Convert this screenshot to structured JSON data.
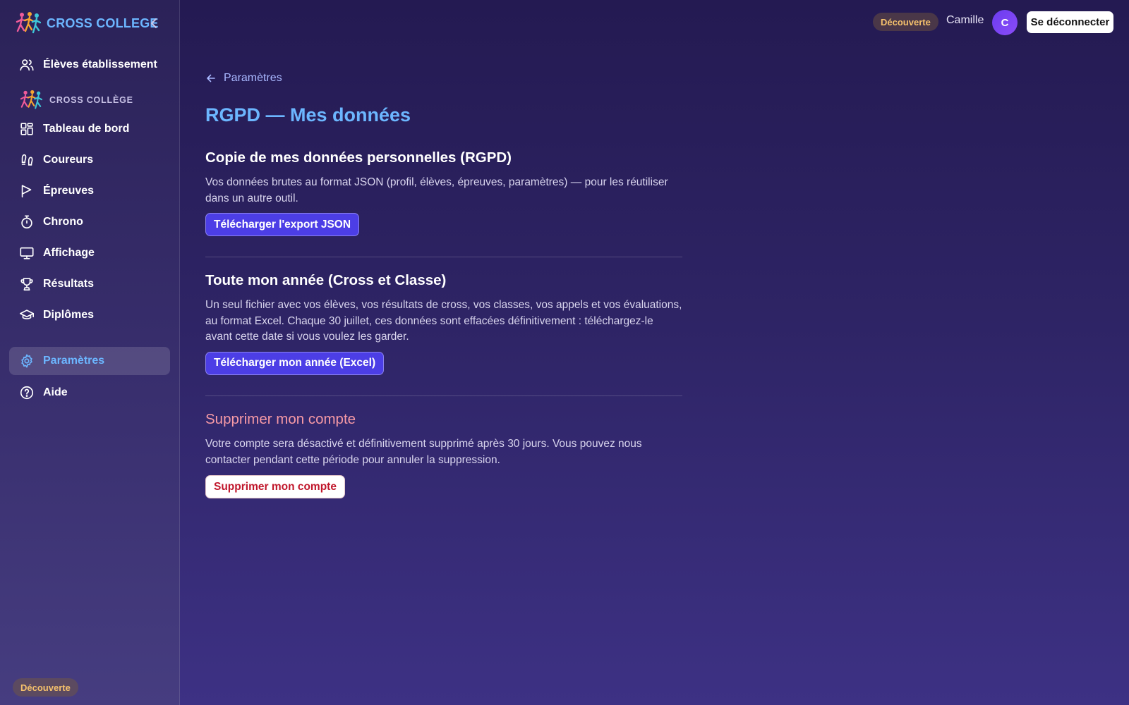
{
  "brand": {
    "name": "CROSS COLLEGE",
    "accent": "#6cb6ff"
  },
  "sidebar": {
    "top_item": {
      "label": "Élèves établissement",
      "icon": "users-icon"
    },
    "section_label": "CROSS COLLÈGE",
    "items": [
      {
        "label": "Tableau de bord",
        "icon": "dashboard-icon"
      },
      {
        "label": "Coureurs",
        "icon": "footprints-icon"
      },
      {
        "label": "Épreuves",
        "icon": "flag-icon"
      },
      {
        "label": "Chrono",
        "icon": "stopwatch-icon"
      },
      {
        "label": "Affichage",
        "icon": "monitor-icon"
      },
      {
        "label": "Résultats",
        "icon": "trophy-icon"
      },
      {
        "label": "Diplômes",
        "icon": "graduation-cap-icon"
      }
    ],
    "settings_item": {
      "label": "Paramètres",
      "icon": "gear-icon",
      "active": true
    },
    "help_item": {
      "label": "Aide",
      "icon": "help-circle-icon"
    },
    "plan_badge": "Découverte"
  },
  "header": {
    "plan_badge": "Découverte",
    "user_name": "Camille",
    "avatar_initial": "C",
    "logout_label": "Se déconnecter"
  },
  "main": {
    "back_label": "Paramètres",
    "title": "RGPD — Mes données",
    "sections": [
      {
        "heading": "Copie de mes données personnelles (RGPD)",
        "description": "Vos données brutes au format JSON (profil, élèves, épreuves, paramètres) — pour les réutiliser dans un autre outil.",
        "button": "Télécharger l'export JSON"
      },
      {
        "heading": "Toute mon année (Cross et Classe)",
        "description": "Un seul fichier avec vos élèves, vos résultats de cross, vos classes, vos appels et vos évaluations, au format Excel. Chaque 30 juillet, ces données sont effacées définitivement : téléchargez-le avant cette date si vous voulez les garder.",
        "button": "Télécharger mon année (Excel)"
      },
      {
        "heading": "Supprimer mon compte",
        "description": "Votre compte sera désactivé et définitivement supprimé après 30 jours. Vous pouvez nous contacter pendant cette période pour annuler la suppression.",
        "button": "Supprimer mon compte"
      }
    ]
  },
  "colors": {
    "primary_button": "#4c3ee6",
    "danger": "#c0162b",
    "danger_heading": "#f79aa6",
    "badge_text": "#f5c16c"
  }
}
